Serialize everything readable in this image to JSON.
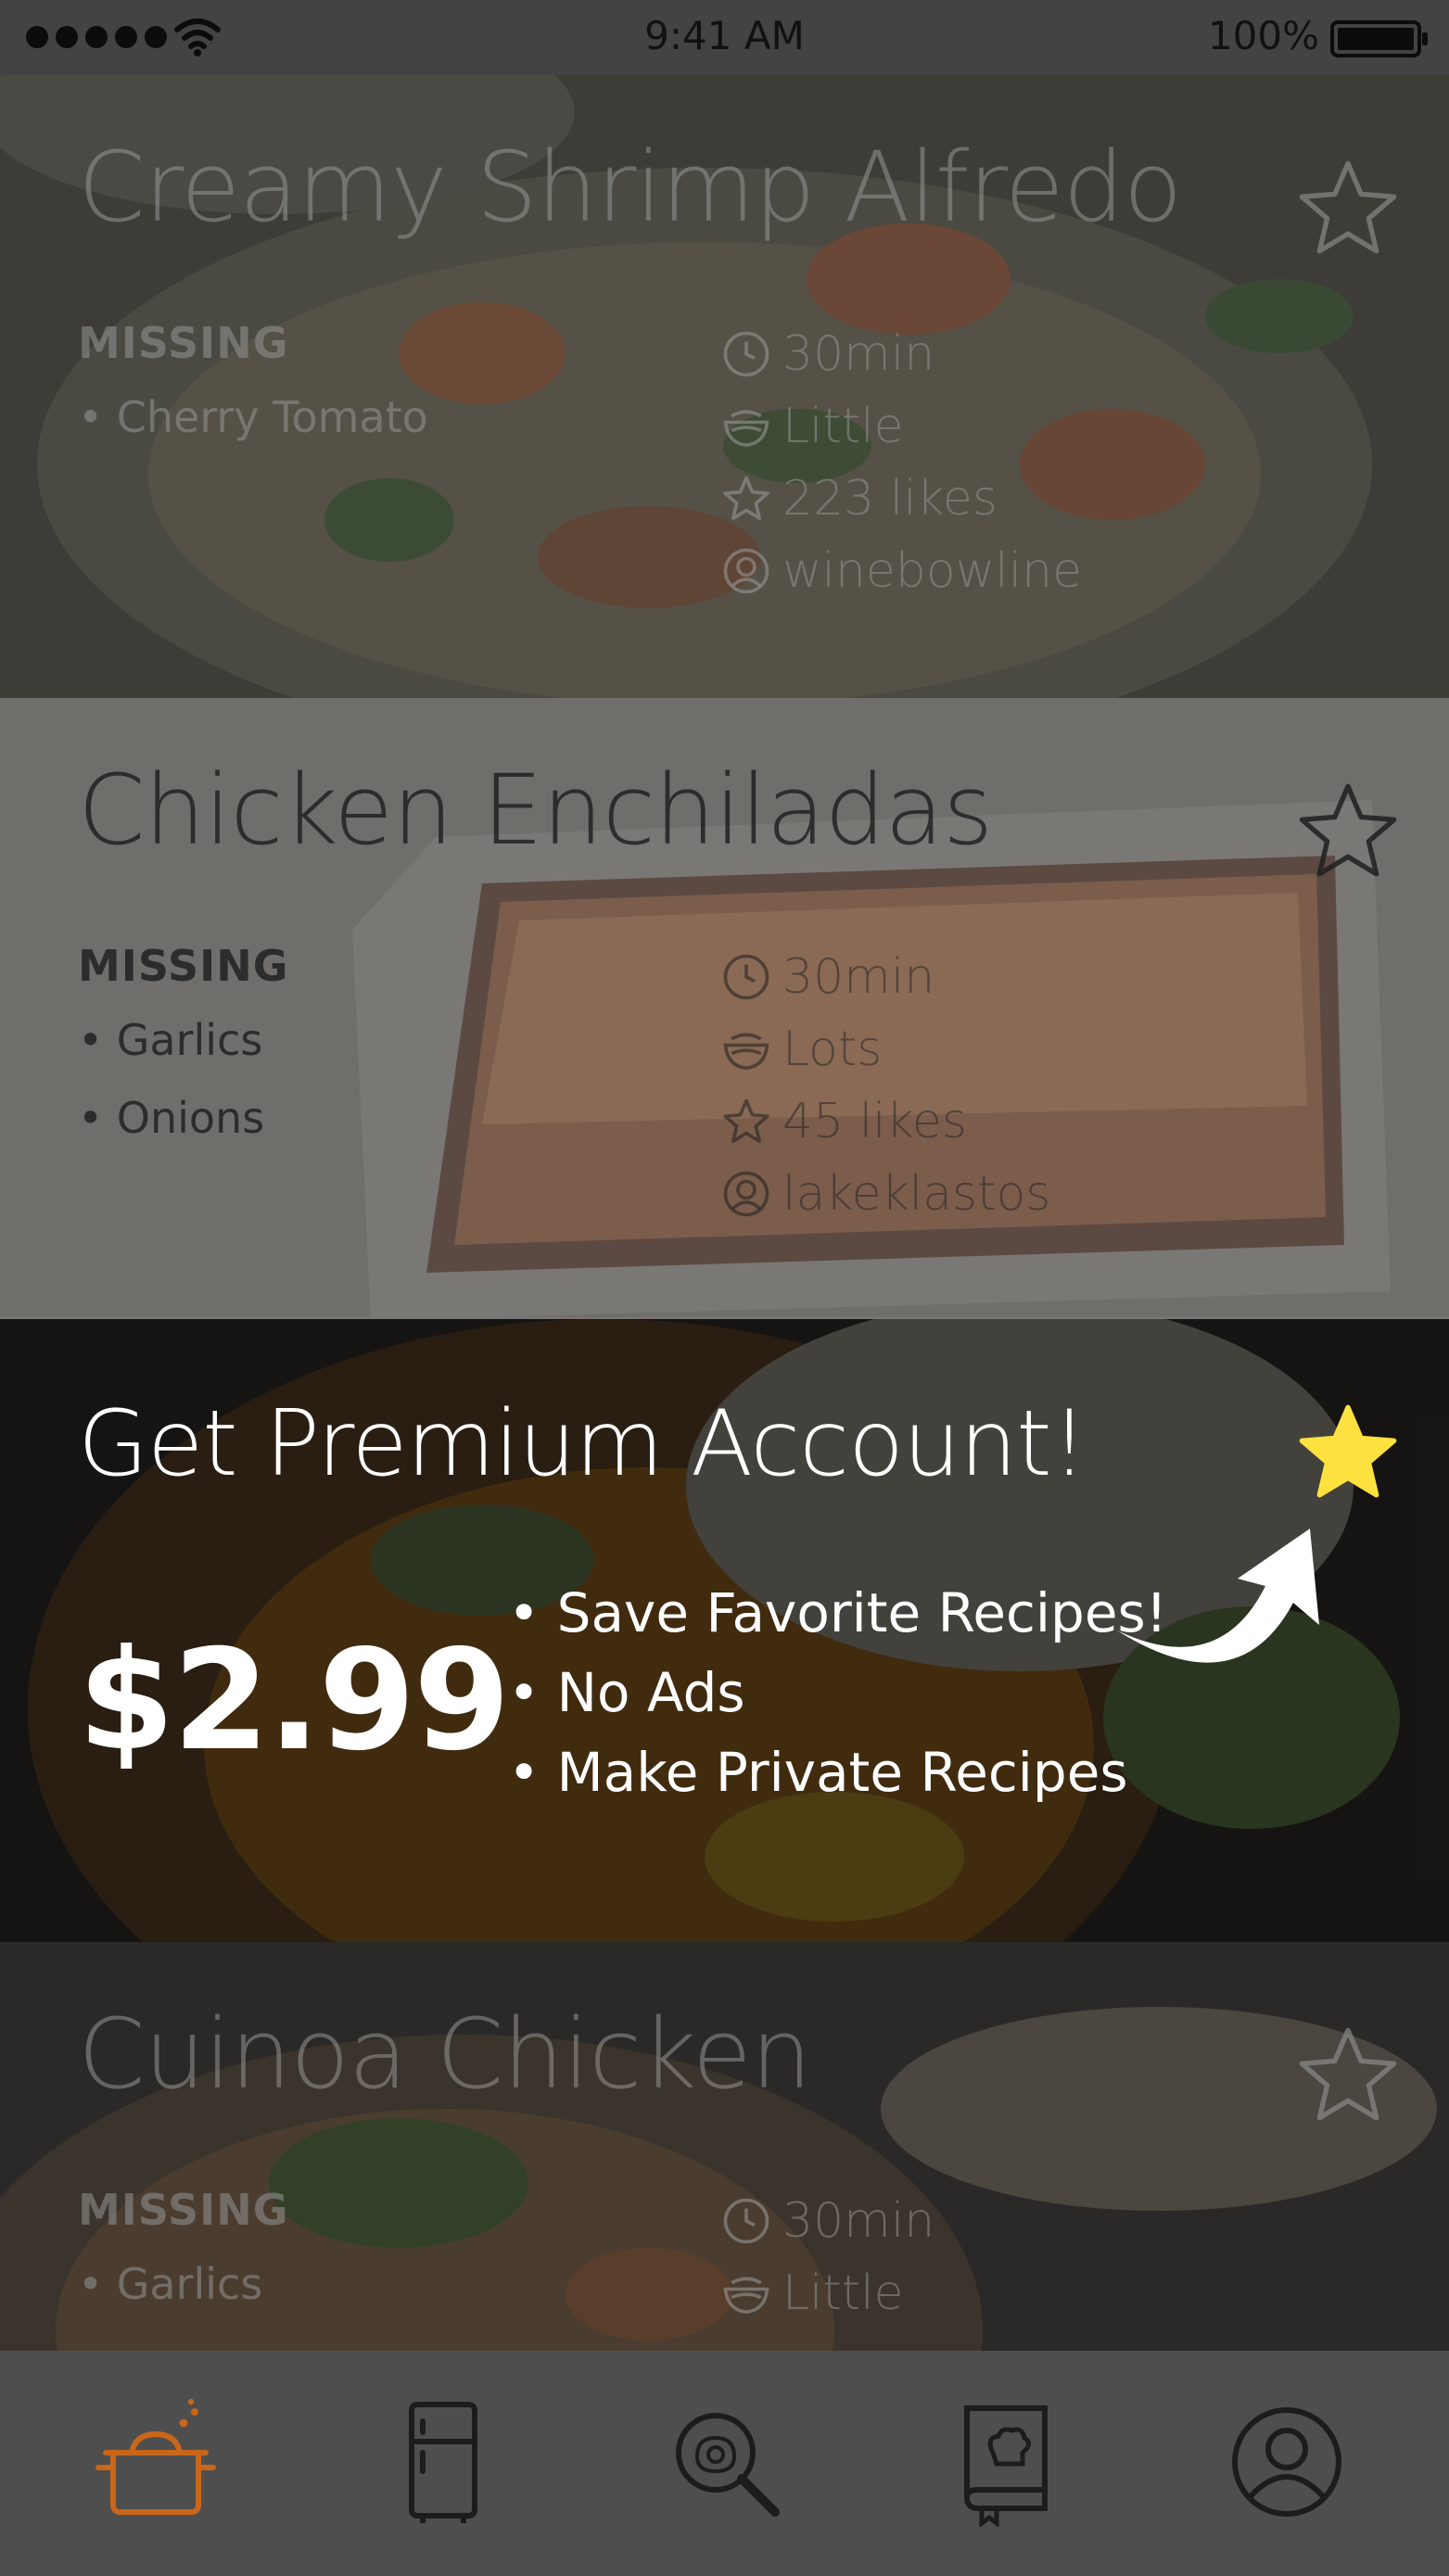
{
  "status_bar": {
    "time": "9:41 AM",
    "battery": "100%"
  },
  "recipes": [
    {
      "title": "Creamy Shrimp Alfredo",
      "missing_heading": "MISSING",
      "missing": [
        "• Cherry Tomato"
      ],
      "time": "30min",
      "portion": "Little",
      "likes": "223 likes",
      "author": "winebowline"
    },
    {
      "title": "Chicken Enchiladas",
      "missing_heading": "MISSING",
      "missing": [
        "• Garlics",
        "• Onions"
      ],
      "time": "30min",
      "portion": "Lots",
      "likes": "45 likes",
      "author": "lakeklastos"
    },
    {
      "title": "Cuinoa Chicken",
      "missing_heading": "MISSING",
      "missing": [
        "• Garlics"
      ],
      "time": "30min",
      "portion": "Little"
    }
  ],
  "premium": {
    "title": "Get Premium Account!",
    "price": "$2.99",
    "features": [
      "• Save Favorite Recipes!",
      "• No Ads",
      "• Make Private Recipes"
    ]
  },
  "tabs": [
    {
      "icon": "cooking-pot-icon",
      "active": true
    },
    {
      "icon": "fridge-icon",
      "active": false
    },
    {
      "icon": "search-food-icon",
      "active": false
    },
    {
      "icon": "recipe-book-icon",
      "active": false
    },
    {
      "icon": "profile-icon",
      "active": false
    }
  ],
  "colors": {
    "accent": "#c8661a",
    "star_active": "#ffe23f",
    "tab_bar": "#4e4e4e"
  }
}
